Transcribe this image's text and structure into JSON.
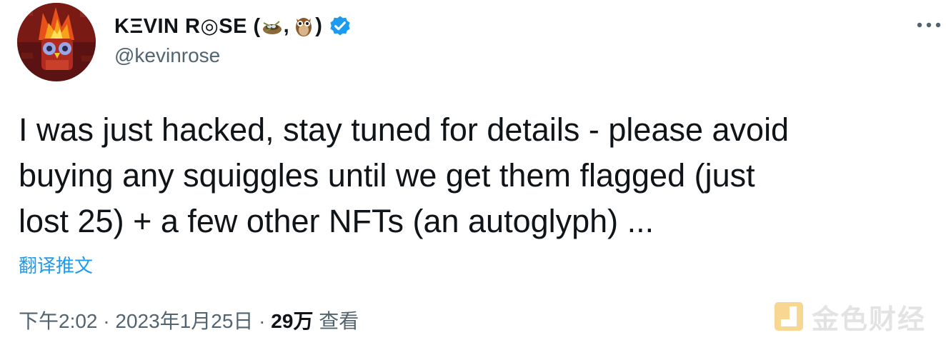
{
  "author": {
    "display_name_prefix": "KΞVIN R◎SE (",
    "display_name_sep": ",",
    "display_name_suffix": ")",
    "handle": "@kevinrose",
    "avatar_icon": "owl-on-fire-avatar",
    "emoji_icons": [
      "nest-icon",
      "owl-icon"
    ],
    "verified_icon": "verified-badge-icon"
  },
  "menu_icon": "more-options-icon",
  "tweet": {
    "line1": "I was just hacked, stay tuned for details - please avoid",
    "line2": "buying any squiggles until we get them flagged (just",
    "line3": "lost 25) + a few other NFTs (an autoglyph) ..."
  },
  "translate_link": "翻译推文",
  "meta": {
    "time": "下午2:02",
    "dot1": " · ",
    "date": "2023年1月25日",
    "dot2": " · ",
    "views_count": "29万",
    "views_label": " 查看"
  },
  "watermark": {
    "text": "金色财经"
  },
  "colors": {
    "link": "#1d9bf0",
    "secondary": "#536471",
    "verified": "#1d9bf0",
    "watermark_logo": "#f2b02a"
  }
}
